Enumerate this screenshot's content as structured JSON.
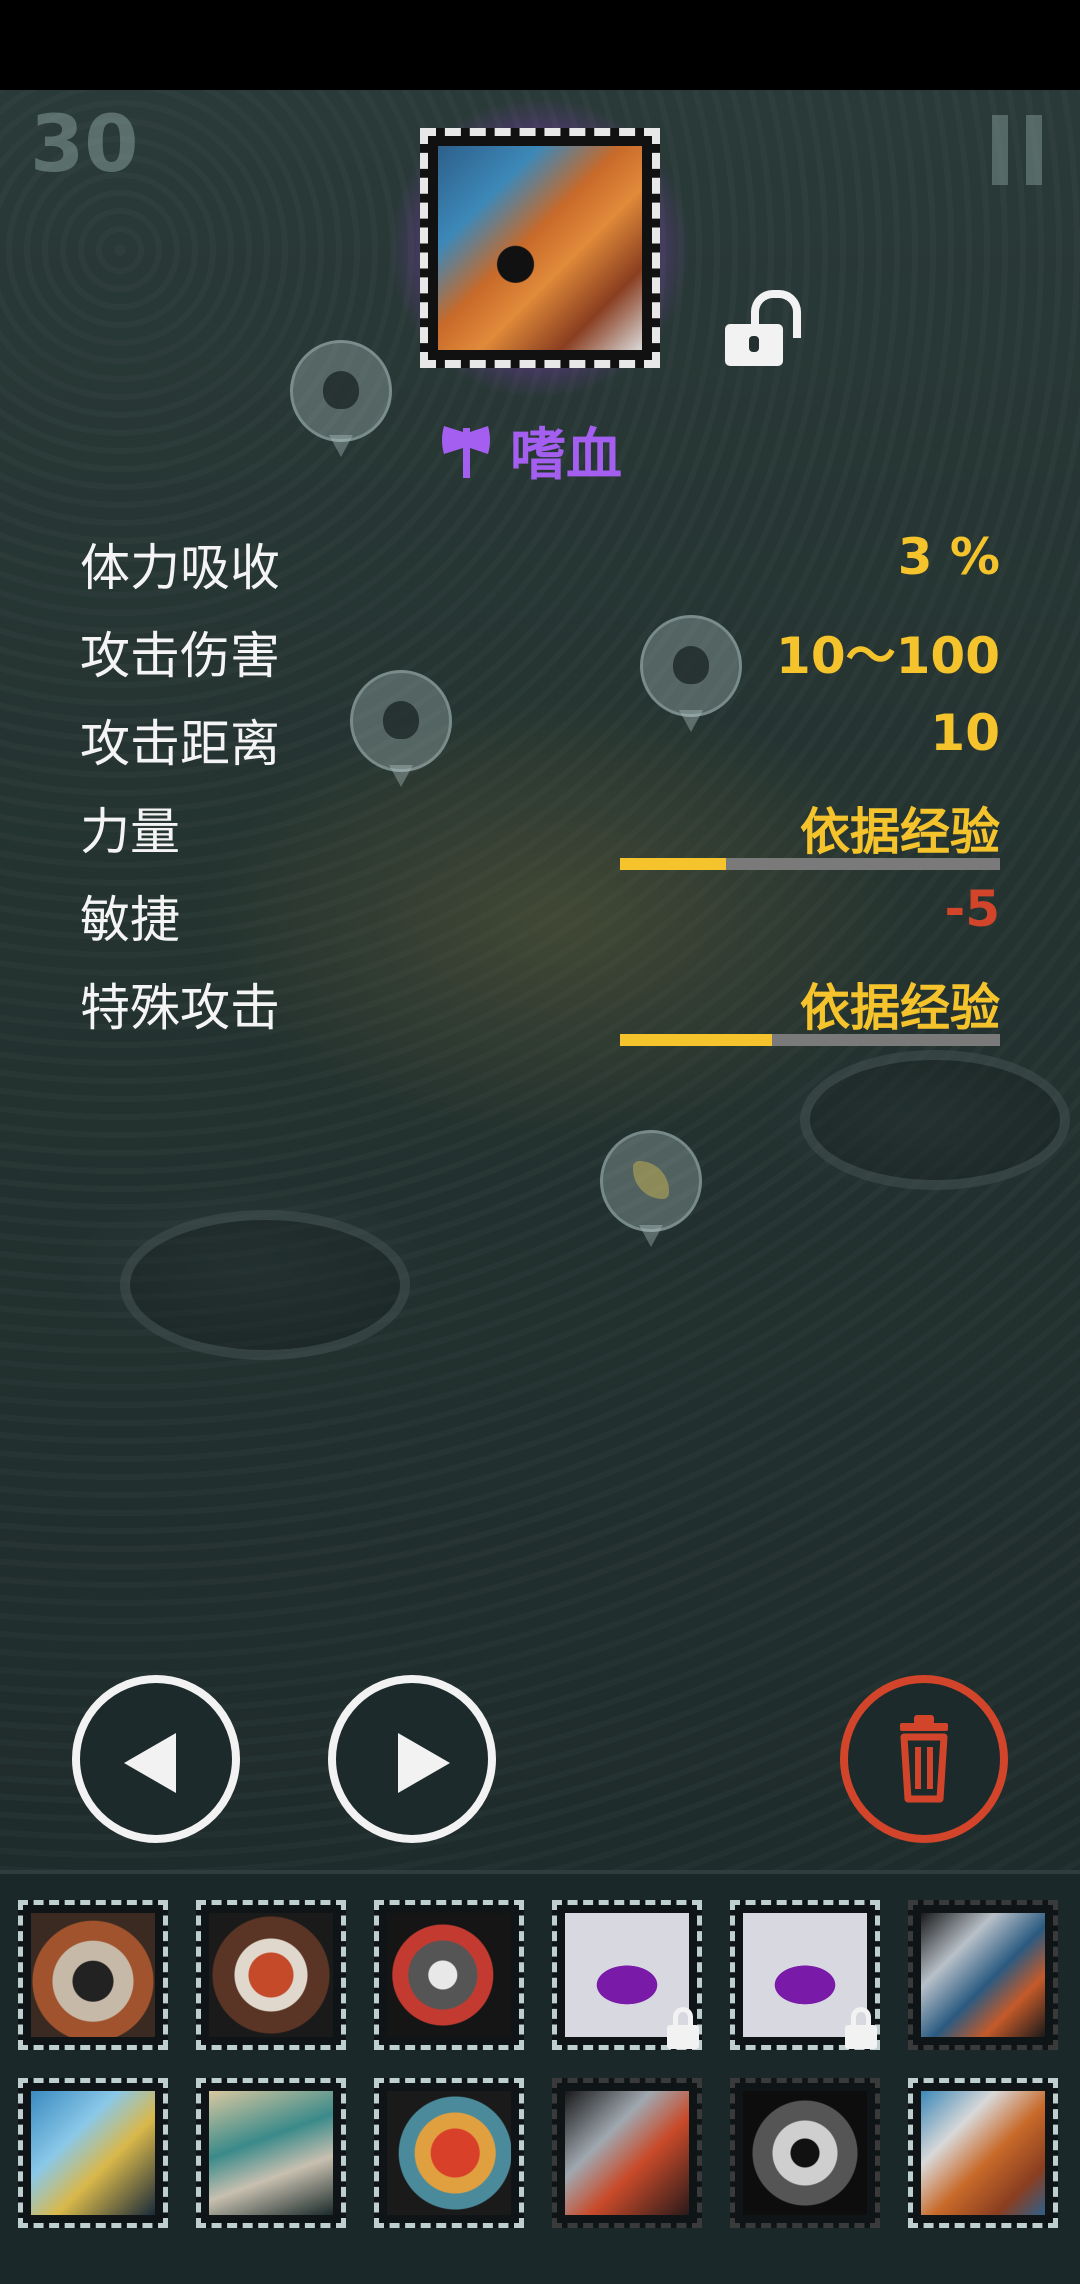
{
  "hud": {
    "level": "30"
  },
  "item": {
    "name": "嗜血",
    "name_color": "#a45ef0",
    "icon": "axe-icon",
    "lock_state": "unlocked"
  },
  "stats": [
    {
      "label": "体力吸收",
      "value": "3 %"
    },
    {
      "label": "攻击伤害",
      "value": "10～100"
    },
    {
      "label": "攻击距离",
      "value": "10"
    },
    {
      "label": "力量",
      "value": "依据经验",
      "progress": 0.28
    },
    {
      "label": "敏捷",
      "value": "-5",
      "negative": true
    },
    {
      "label": "特殊攻击",
      "value": "依据经验",
      "progress": 0.4
    }
  ],
  "colors": {
    "value": "#f5c32c",
    "negative": "#d2452a",
    "accent": "#a45ef0"
  },
  "controls": {
    "prev": "chevron-left-icon",
    "next": "chevron-right-icon",
    "delete": "trash-icon"
  },
  "inventory": {
    "rows": [
      [
        {
          "icon": "shield-item-icon",
          "locked": false
        },
        {
          "icon": "claw-item-icon",
          "locked": false
        },
        {
          "icon": "helmet-item-icon",
          "locked": false
        },
        {
          "icon": "purple-ring-icon",
          "locked": true
        },
        {
          "icon": "purple-ring-icon",
          "locked": true
        },
        {
          "icon": "blade-item-icon",
          "locked": false
        }
      ],
      [
        {
          "icon": "crossbow-item-icon",
          "locked": false
        },
        {
          "icon": "armor-item-icon",
          "locked": false
        },
        {
          "icon": "beast-item-icon",
          "locked": false
        },
        {
          "icon": "dagger-item-icon",
          "locked": false
        },
        {
          "icon": "skull-item-icon",
          "locked": false
        },
        {
          "icon": "axe-item-icon",
          "locked": false
        }
      ]
    ]
  }
}
